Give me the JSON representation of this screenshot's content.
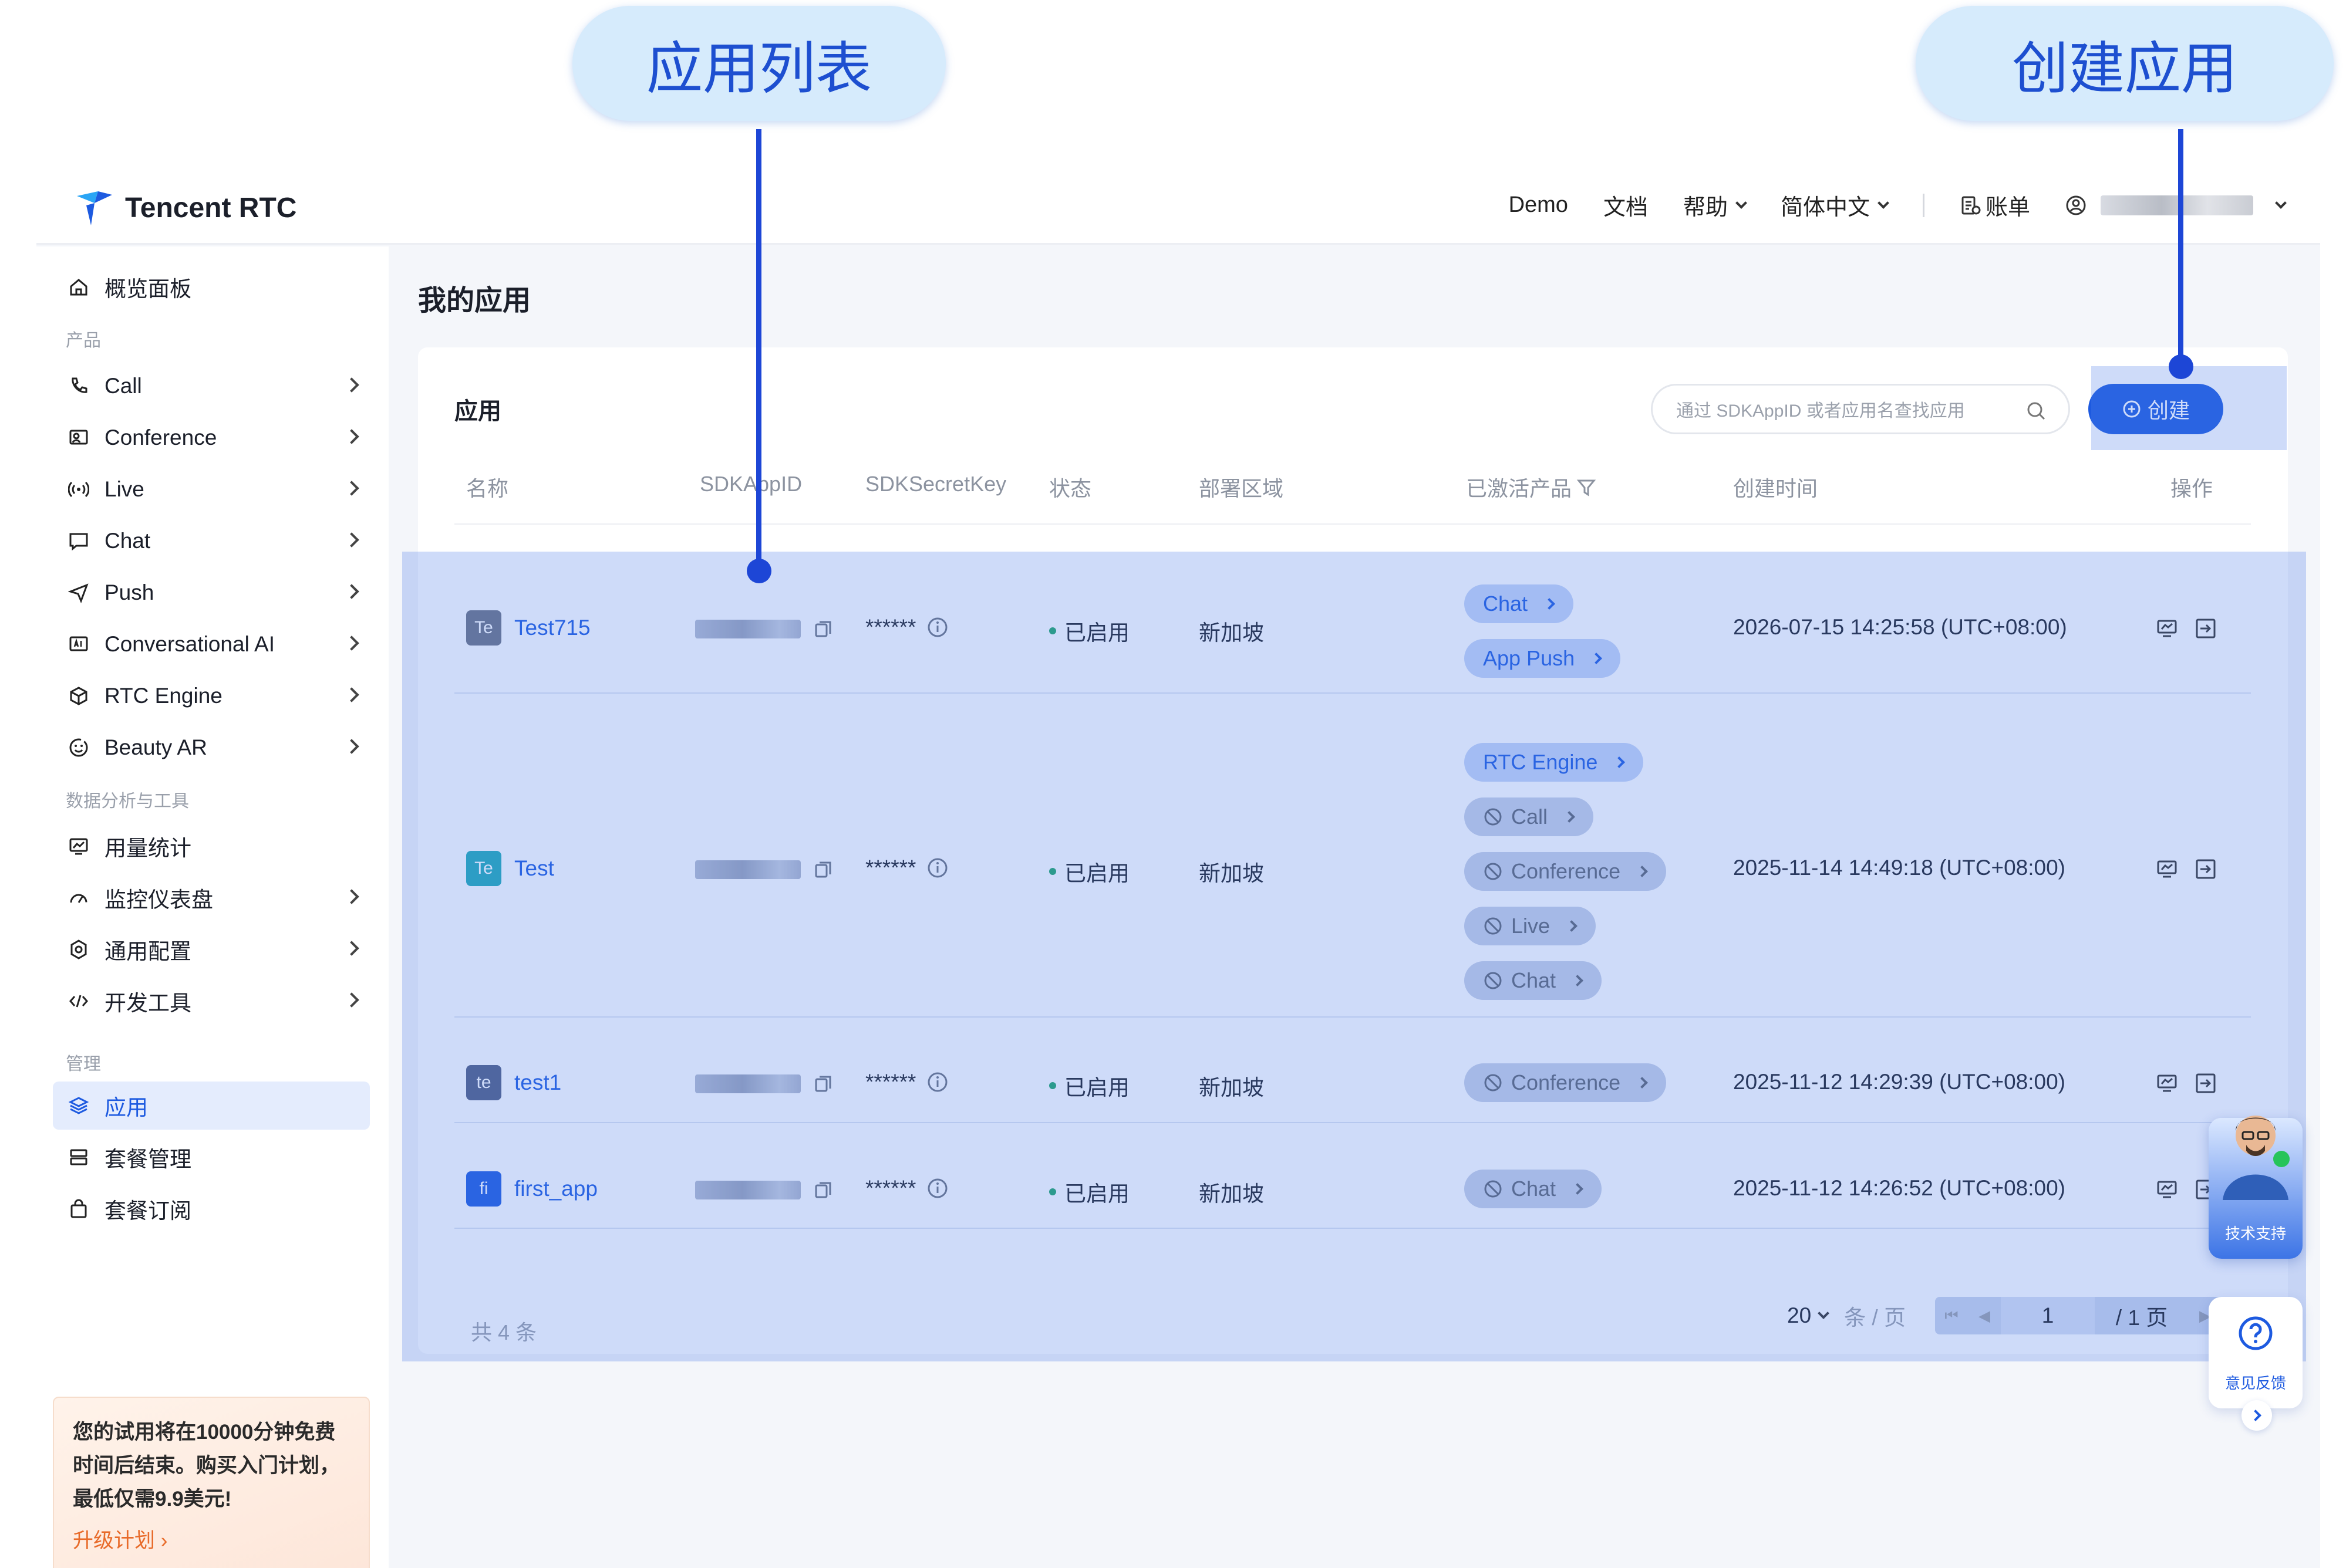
{
  "annotations": {
    "list_label": "应用列表",
    "create_label": "创建应用"
  },
  "brand": {
    "name": "Tencent RTC",
    "accent": "#1d5ae0",
    "highlight": "#507deb"
  },
  "topnav": {
    "demo": "Demo",
    "docs": "文档",
    "help": "帮助",
    "language": "简体中文",
    "billing": "账单"
  },
  "sidebar": {
    "overview": "概览面板",
    "section_products": "产品",
    "products": [
      "Call",
      "Conference",
      "Live",
      "Chat",
      "Push",
      "Conversational AI",
      "RTC Engine",
      "Beauty AR"
    ],
    "section_tools": "数据分析与工具",
    "tools": [
      "用量统计",
      "监控仪表盘",
      "通用配置",
      "开发工具"
    ],
    "section_manage": "管理",
    "manage": [
      "应用",
      "套餐管理",
      "套餐订阅"
    ],
    "promo_line1": "您的试用将在10000分钟免费",
    "promo_line2": "时间后结束。购买入门计划，",
    "promo_line3": "最低仅需9.9美元!",
    "promo_link": "升级计划"
  },
  "main": {
    "page_title": "我的应用",
    "card_title": "应用",
    "search_placeholder": "通过 SDKAppID 或者应用名查找应用",
    "create_label": "创建",
    "columns": {
      "name": "名称",
      "sdkappid": "SDKAppID",
      "secret": "SDKSecretKey",
      "status": "状态",
      "region": "部署区域",
      "products": "已激活产品",
      "created": "创建时间",
      "actions": "操作"
    },
    "rows": [
      {
        "avatar": "Te",
        "avatar_color": "#6b7284",
        "name": "Test715",
        "secret": "******",
        "status": "已启用",
        "region": "新加坡",
        "products": [
          "Chat",
          "App Push"
        ],
        "created": "2026-07-15 14:25:58 (UTC+08:00)"
      },
      {
        "avatar": "Te",
        "avatar_color": "#21a9b8",
        "name": "Test",
        "secret": "******",
        "status": "已启用",
        "region": "新加坡",
        "products": [
          "RTC Engine",
          "Call",
          "Conference",
          "Live",
          "Chat"
        ],
        "created": "2025-11-14 14:49:18 (UTC+08:00)"
      },
      {
        "avatar": "te",
        "avatar_color": "#4f5d84",
        "name": "test1",
        "secret": "******",
        "status": "已启用",
        "region": "新加坡",
        "products": [
          "Conference"
        ],
        "created": "2025-11-12 14:29:39 (UTC+08:00)"
      },
      {
        "avatar": "fi",
        "avatar_color": "#1d5ae0",
        "name": "first_app",
        "secret": "******",
        "status": "已启用",
        "region": "新加坡",
        "products": [
          "Chat"
        ],
        "created": "2025-11-12 14:26:52 (UTC+08:00)"
      }
    ],
    "total": "共 4 条",
    "page_size": "20",
    "page_size_unit": "条 / 页",
    "page_current": "1",
    "page_total": "/ 1 页"
  },
  "floating": {
    "support": "技术支持",
    "feedback": "意见反馈"
  }
}
